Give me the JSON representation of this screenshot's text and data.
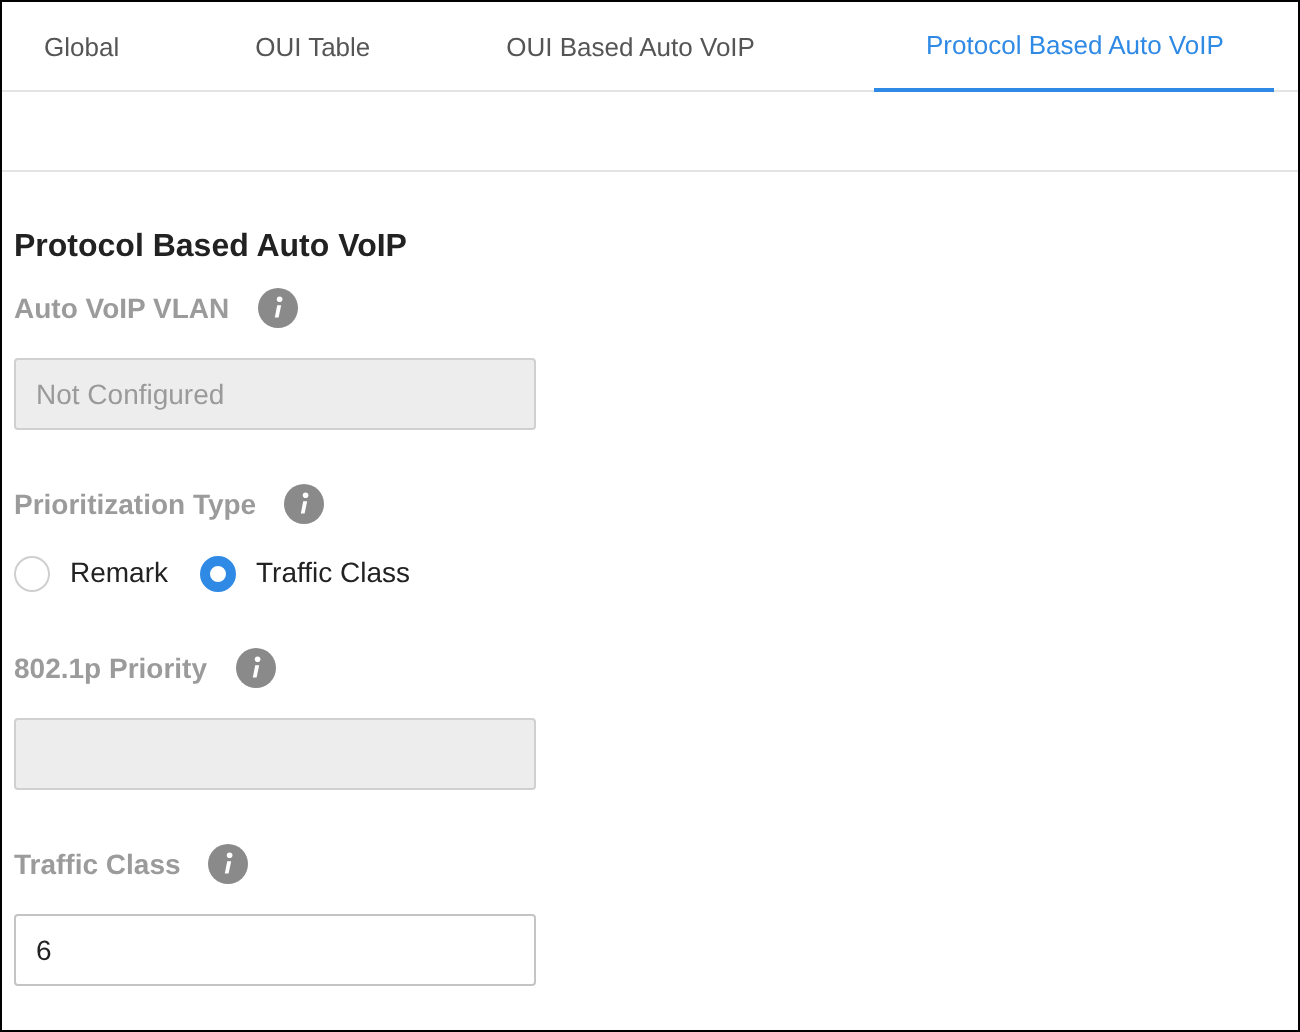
{
  "tabs": [
    {
      "label": "Global",
      "selected": false
    },
    {
      "label": "OUI Table",
      "selected": false
    },
    {
      "label": "OUI Based Auto VoIP",
      "selected": false
    },
    {
      "label": "Protocol Based Auto VoIP",
      "selected": true
    }
  ],
  "section_title": "Protocol Based Auto VoIP",
  "fields": [
    {
      "kind": "text",
      "label": "Auto VoIP VLAN",
      "placeholder": "Not Configured",
      "disabled": true
    },
    {
      "kind": "radio",
      "label": "Prioritization Type",
      "options": [
        {
          "label": "Remark",
          "selected": false
        },
        {
          "label": "Traffic Class",
          "selected": true
        }
      ]
    },
    {
      "kind": "text",
      "label": "802.1p Priority",
      "disabled": true
    },
    {
      "kind": "text",
      "label": "Traffic Class",
      "value": "6",
      "disabled": false
    }
  ]
}
